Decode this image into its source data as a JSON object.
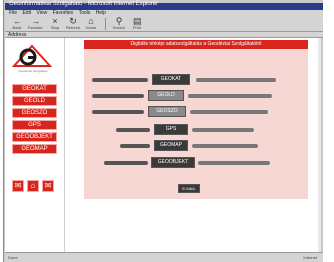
{
  "window": {
    "title": "Geoinformatikai Szolgaltato - Microsoft Internet Explorer"
  },
  "menubar": {
    "items": [
      "File",
      "Edit",
      "View",
      "Favorites",
      "Tools",
      "Help"
    ]
  },
  "toolbar": {
    "buttons": [
      {
        "label": "Back",
        "icon": "back-arrow-icon",
        "glyph": "←"
      },
      {
        "label": "Forward",
        "icon": "forward-arrow-icon",
        "glyph": "→"
      },
      {
        "label": "Stop",
        "icon": "stop-icon",
        "glyph": "×"
      },
      {
        "label": "Refresh",
        "icon": "refresh-icon",
        "glyph": "↻"
      },
      {
        "label": "Home",
        "icon": "home-icon",
        "glyph": "⌂"
      },
      {
        "label": "Search",
        "icon": "search-icon",
        "glyph": "⚲"
      },
      {
        "label": "Print",
        "icon": "print-icon",
        "glyph": "▤"
      }
    ]
  },
  "address": {
    "label": "Address"
  },
  "sidebar": {
    "logo_caption": "Geodéziai Szolgáltató",
    "nav": [
      "GEOKAT",
      "GEOLD",
      "GEOSZO",
      "GPS",
      "GEOOBJEKT",
      "GEOMAP"
    ],
    "small_buttons": [
      {
        "icon": "mail-icon",
        "glyph": "✉"
      },
      {
        "icon": "home-icon",
        "glyph": "⌂"
      },
      {
        "icon": "mail-icon",
        "glyph": "✉"
      }
    ]
  },
  "main": {
    "header": "Digitális térképi adatszolgáltatás a Geodéziai Szolgáltatótól",
    "rows": [
      {
        "button": "GEOKAT",
        "dark": true
      },
      {
        "button": "GEOLD",
        "dark": false
      },
      {
        "button": "GEOSZO",
        "dark": false
      },
      {
        "button": "GPS",
        "dark": true
      },
      {
        "button": "GEOMAP",
        "dark": true
      },
      {
        "button": "GEOOBJEKT",
        "dark": true
      }
    ],
    "footer_button": "E-MAIL"
  },
  "status": {
    "left": "Done",
    "right": "Internet"
  },
  "colors": {
    "accent": "#d8261f",
    "panel": "#f7d7d4",
    "titlebar": "#2a3a8a"
  }
}
